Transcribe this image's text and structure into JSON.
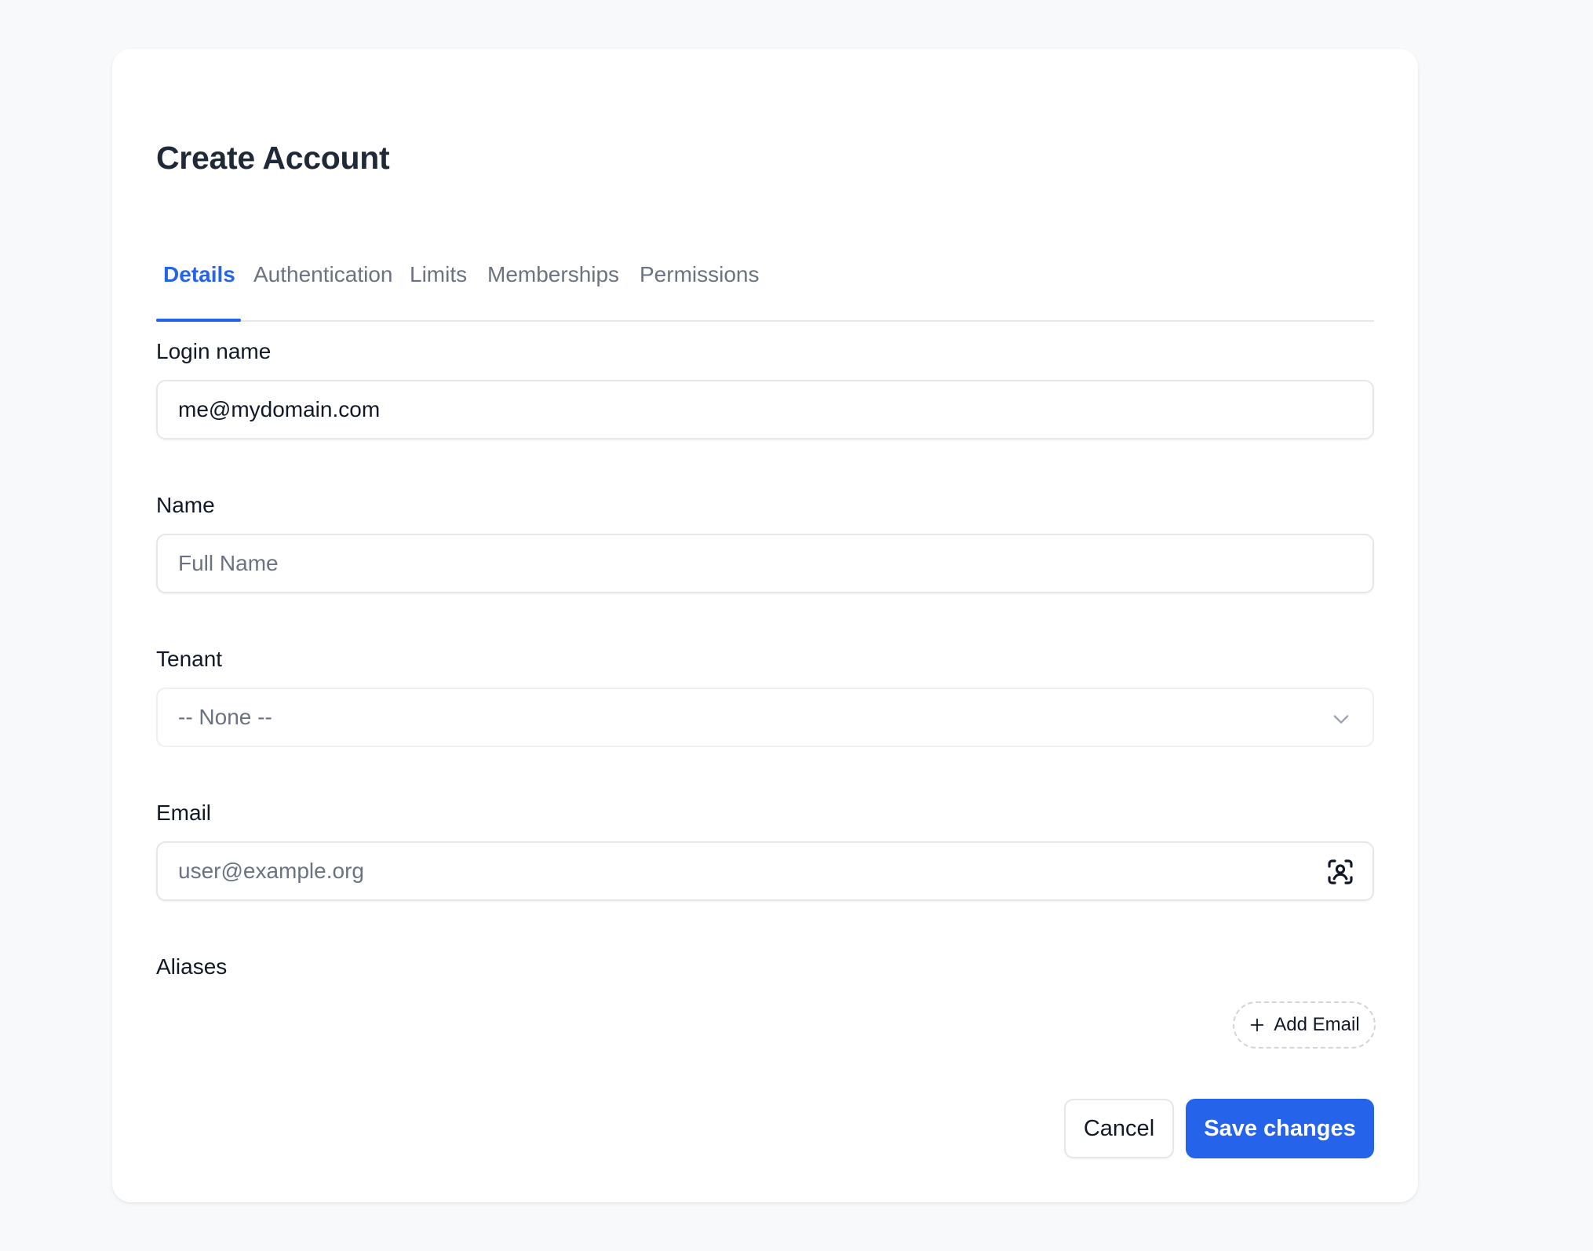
{
  "page": {
    "title": "Create Account"
  },
  "tabs": [
    {
      "label": "Details",
      "active": true
    },
    {
      "label": "Authentication",
      "active": false
    },
    {
      "label": "Limits",
      "active": false
    },
    {
      "label": "Memberships",
      "active": false
    },
    {
      "label": "Permissions",
      "active": false
    }
  ],
  "form": {
    "login_name": {
      "label": "Login name",
      "value": "me@mydomain.com"
    },
    "name": {
      "label": "Name",
      "placeholder": "Full Name"
    },
    "tenant": {
      "label": "Tenant",
      "selected": "-- None --"
    },
    "email": {
      "label": "Email",
      "placeholder": "user@example.org",
      "icon": "user-scan-icon"
    },
    "aliases": {
      "label": "Aliases",
      "add_label": "Add Email"
    }
  },
  "actions": {
    "cancel_label": "Cancel",
    "save_label": "Save changes"
  },
  "colors": {
    "accent": "#2563eb",
    "background": "#f8f9fb",
    "card": "#ffffff",
    "muted_text": "#6b7280",
    "border": "#e5e7eb"
  }
}
